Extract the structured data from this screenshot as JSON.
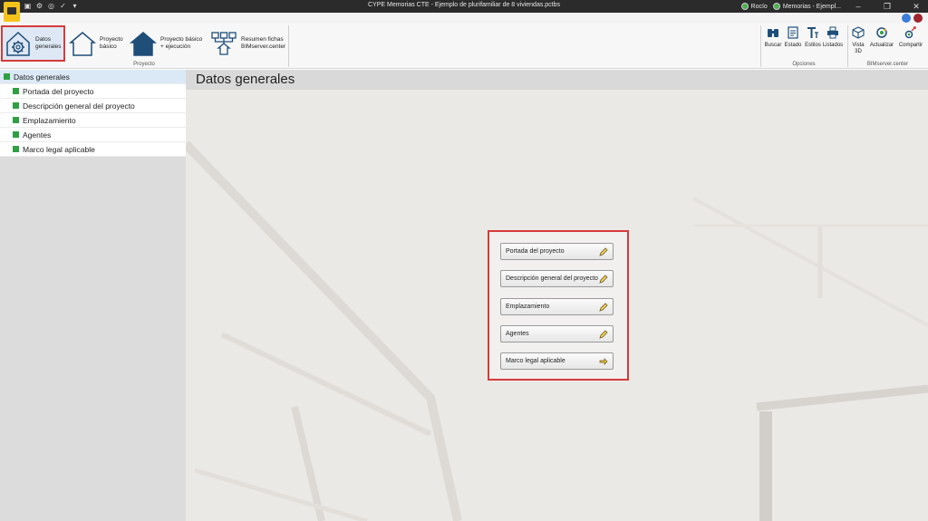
{
  "window": {
    "title": "CYPE Memorias CTE - Ejemplo de plurifamiliar de 8 viviendas.pctbs",
    "user": "Rocío",
    "module": "Memorias - Ejempl..."
  },
  "ribbon": {
    "proyecto_group": {
      "label": "Proyecto",
      "datos_generales": "Datos\ngenerales",
      "proyecto_basico": "Proyecto\nbásico",
      "proyecto_basico_ejecucion": "Proyecto básico\n+ ejecución",
      "resumen_fichas": "Resumen fichas\nBIMserver.center"
    },
    "opciones_group": {
      "label": "Opciones",
      "buscar": "Buscar",
      "estado": "Estado",
      "estilos": "Estilos",
      "listados": "Listados"
    },
    "bimserver_group": {
      "label": "BIMserver.center",
      "vista3d": "Vista\n3D",
      "actualizar": "Actualizar",
      "compartir": "Compartir"
    }
  },
  "sidebar": {
    "root": "Datos generales",
    "items": [
      {
        "label": "Portada del proyecto"
      },
      {
        "label": "Descripción general del proyecto"
      },
      {
        "label": "Emplazamiento"
      },
      {
        "label": "Agentes"
      },
      {
        "label": "Marco legal aplicable"
      }
    ]
  },
  "main": {
    "header": "Datos generales",
    "buttons": [
      {
        "label": "Portada del proyecto",
        "icon": "pencil-icon"
      },
      {
        "label": "Descripción general del proyecto",
        "icon": "pencil-icon"
      },
      {
        "label": "Emplazamiento",
        "icon": "pencil-icon"
      },
      {
        "label": "Agentes",
        "icon": "pencil-icon"
      },
      {
        "label": "Marco legal aplicable",
        "icon": "arrow-right-icon"
      }
    ]
  },
  "colors": {
    "accent_red": "#d43b3b",
    "tree_green": "#2ea043",
    "brand_blue": "#1f4e79"
  }
}
